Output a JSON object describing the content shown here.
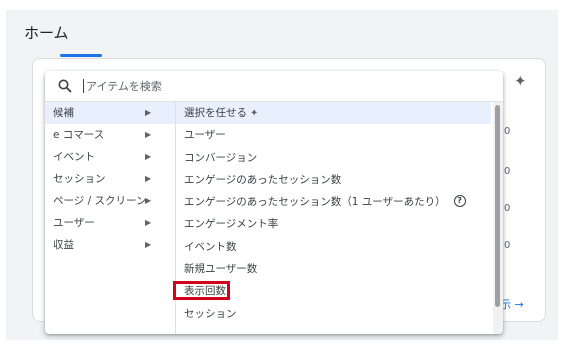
{
  "page": {
    "title": "ホーム"
  },
  "card": {
    "view_more": "示 →",
    "edge_chars": [
      "0",
      "0",
      "0",
      "0",
      "0"
    ]
  },
  "search": {
    "placeholder": "アイテムを検索",
    "value": ""
  },
  "categories": [
    {
      "label": "候補",
      "selected": true
    },
    {
      "label": "e コマース"
    },
    {
      "label": "イベント"
    },
    {
      "label": "セッション"
    },
    {
      "label": "ページ / スクリーン"
    },
    {
      "label": "ユーザー"
    },
    {
      "label": "収益"
    }
  ],
  "metrics": [
    {
      "label": "選択を任せる",
      "icon": "sparkle-icon"
    },
    {
      "label": "ユーザー"
    },
    {
      "label": "コンバージョン"
    },
    {
      "label": "エンゲージのあったセッション数"
    },
    {
      "label": "エンゲージのあったセッション数（1 ユーザーあたり）",
      "icon": "help-icon"
    },
    {
      "label": "エンゲージメント率"
    },
    {
      "label": "イベント数"
    },
    {
      "label": "新規ユーザー数"
    },
    {
      "label": "表示回数",
      "highlighted": true
    },
    {
      "label": "セッション"
    }
  ],
  "colors": {
    "accent": "#1a73e8",
    "selected_bg": "#e8f0fe",
    "annotation_red": "#d5001c"
  }
}
